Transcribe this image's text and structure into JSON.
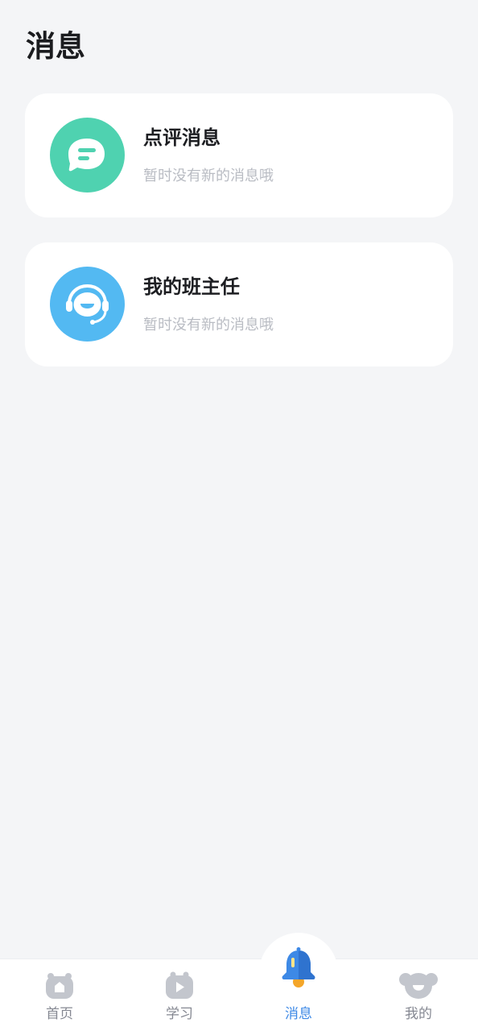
{
  "page": {
    "title": "消息"
  },
  "messages": [
    {
      "title": "点评消息",
      "subtitle": "暂时没有新的消息哦",
      "icon": "comment-bubble-icon",
      "color": "#4fd2b0"
    },
    {
      "title": "我的班主任",
      "subtitle": "暂时没有新的消息哦",
      "icon": "headset-smiley-icon",
      "color": "#53b9f2"
    }
  ],
  "tabbar": {
    "items": [
      {
        "label": "首页",
        "icon": "home-icon",
        "active": false
      },
      {
        "label": "学习",
        "icon": "play-icon",
        "active": false
      },
      {
        "label": "消息",
        "icon": "bell-icon",
        "active": true
      },
      {
        "label": "我的",
        "icon": "bear-face-icon",
        "active": false
      }
    ],
    "active_color": "#3d89e6",
    "inactive_color": "#858892"
  }
}
